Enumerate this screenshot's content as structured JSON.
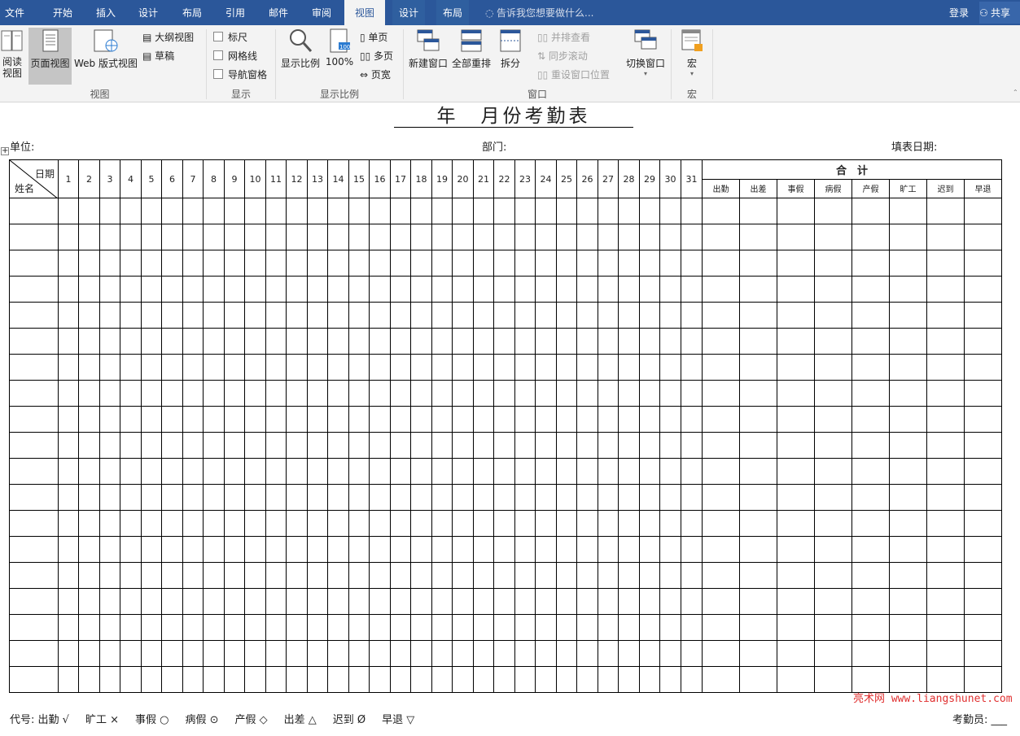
{
  "tabs": [
    "文件",
    "开始",
    "插入",
    "设计",
    "布局",
    "引用",
    "邮件",
    "审阅",
    "视图",
    "设计",
    "布局"
  ],
  "active_tab": "视图",
  "tellme": "告诉我您想要做什么...",
  "login": "登录",
  "share": "共享",
  "ribbon": {
    "views": {
      "read": "阅读\n视图",
      "page": "页面视图",
      "web": "Web 版式视图",
      "outline": "大纲视图",
      "draft": "草稿",
      "label": "视图"
    },
    "show": {
      "ruler": "标尺",
      "grid": "网格线",
      "nav": "导航窗格",
      "label": "显示"
    },
    "zoom": {
      "zoom": "显示比例",
      "percent": "100%",
      "one": "单页",
      "multi": "多页",
      "width": "页宽",
      "label": "显示比例"
    },
    "window": {
      "new": "新建窗口",
      "arrange": "全部重排",
      "split": "拆分",
      "side": "并排查看",
      "sync": "同步滚动",
      "reset": "重设窗口位置",
      "switch": "切换窗口",
      "label": "窗口"
    },
    "macro": {
      "macro": "宏",
      "label": "宏"
    }
  },
  "doc": {
    "title": "年　月份考勤表",
    "unit": "单位:",
    "dept": "部门:",
    "fill_date": "填表日期:",
    "date_hdr": "日期",
    "name_hdr": "姓名",
    "days": [
      "1",
      "2",
      "3",
      "4",
      "5",
      "6",
      "7",
      "8",
      "9",
      "10",
      "11",
      "12",
      "13",
      "14",
      "15",
      "16",
      "17",
      "18",
      "19",
      "20",
      "21",
      "22",
      "23",
      "24",
      "25",
      "26",
      "27",
      "28",
      "29",
      "30",
      "31"
    ],
    "total": "合　计",
    "totals": [
      "出勤",
      "出差",
      "事假",
      "病假",
      "产假",
      "旷工",
      "迟到",
      "早退"
    ],
    "legend": [
      "代号: 出勤 √",
      "旷工 ×",
      "事假 ○",
      "病假 ⊙",
      "产假 ◇",
      "出差 △",
      "迟到 Ø",
      "早退 ▽"
    ],
    "checker": "考勤员: ___",
    "watermark": "亮术网 www.liangshunet.com"
  }
}
